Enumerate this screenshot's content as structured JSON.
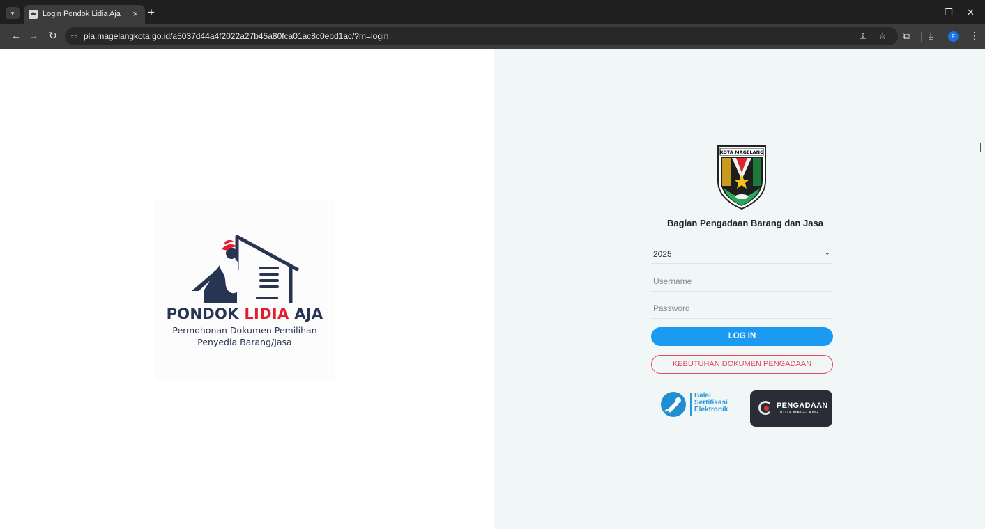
{
  "browser": {
    "tab_title": "Login Pondok Lidia Aja",
    "tab_close": "×",
    "new_tab": "+",
    "url": "pla.magelangkota.go.id/a5037d44a4f2022a27b45a80fca01ac8c0ebd1ac/?m=login",
    "profile_initial": "F",
    "icons": [
      "tab-list-icon",
      "back-icon",
      "forward-icon",
      "reload-icon",
      "site-info-icon",
      "password-key-icon",
      "bookmark-star-icon",
      "extensions-icon",
      "download-icon",
      "menu-icon",
      "minimize-icon",
      "restore-icon",
      "close-icon"
    ]
  },
  "logo": {
    "brand_part1": "PONDOK ",
    "brand_part2": "LIDIA",
    "brand_part3": " AJA",
    "tagline1": "Permohonan Dokumen Pemilihan",
    "tagline2": "Penyedia Barang/Jasa",
    "colors": {
      "navy": "#273452",
      "red": "#e31e2f"
    }
  },
  "login": {
    "emblem_label": "KOTA MAGELANG",
    "org_title": "Bagian Pengadaan Barang dan Jasa",
    "year_value": "2025",
    "username_placeholder": "Username",
    "password_placeholder": "Password",
    "login_button": "LOG IN",
    "docs_button": "KEBUTUHAN DOKUMEN PENGADAAN",
    "colors": {
      "login_btn": "#1a9af0",
      "outline_btn": "#e84560",
      "panel_bg": "#f1f7f7"
    }
  },
  "partners": {
    "bse_line1": "Balai",
    "bse_line2": "Sertifikasi",
    "bse_line3": "Elektronik",
    "pengadaan_title": "PENGADAAN",
    "pengadaan_sub": "KOTA MAGELANG"
  }
}
